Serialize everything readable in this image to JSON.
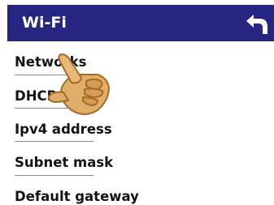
{
  "header": {
    "title": "Wi-Fi",
    "back_icon": "back-arrow-icon",
    "background_color": "#262682"
  },
  "menu": {
    "items": [
      {
        "label": "Networks"
      },
      {
        "label": "DHCP"
      },
      {
        "label": "Ipv4 address"
      },
      {
        "label": "Subnet mask"
      },
      {
        "label": "Default gateway"
      }
    ]
  },
  "pointer": {
    "icon": "tap-hand-icon"
  }
}
